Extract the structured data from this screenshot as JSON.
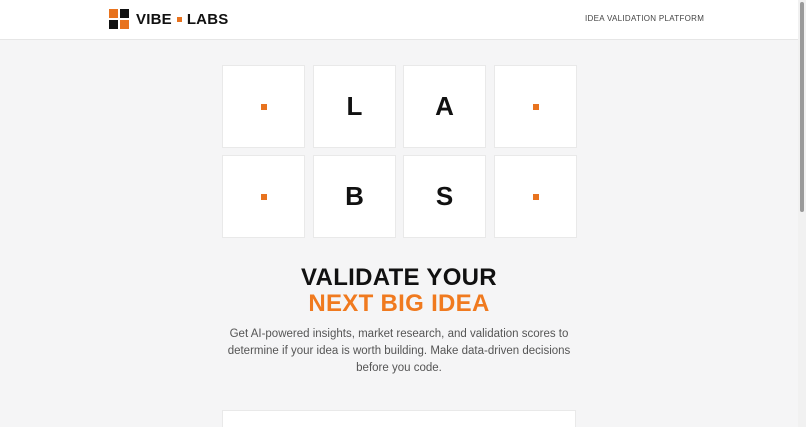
{
  "header": {
    "brand_left": "VIBE",
    "brand_right": "LABS",
    "tagline": "IDEA VALIDATION PLATFORM"
  },
  "tiles": [
    {
      "type": "dot"
    },
    {
      "type": "letter",
      "text": "L"
    },
    {
      "type": "letter",
      "text": "A"
    },
    {
      "type": "dot"
    },
    {
      "type": "dot"
    },
    {
      "type": "letter",
      "text": "B"
    },
    {
      "type": "letter",
      "text": "S"
    },
    {
      "type": "dot"
    }
  ],
  "hero": {
    "title_line1": "VALIDATE YOUR",
    "title_line2": "NEXT BIG IDEA",
    "description": "Get AI-powered insights, market research, and validation scores to determine if your idea is worth building. Make data-driven decisions before you code."
  },
  "colors": {
    "accent": "#f07a1f",
    "text": "#111111",
    "background": "#f5f5f6"
  }
}
